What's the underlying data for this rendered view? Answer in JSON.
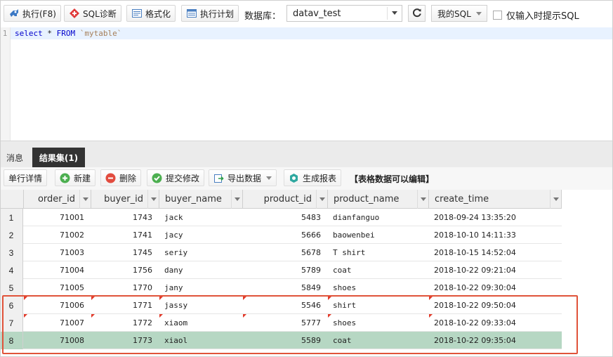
{
  "toolbar": {
    "execute_label": "执行(F8)",
    "sql_diagnose_label": "SQL诊断",
    "format_label": "格式化",
    "plan_label": "执行计划",
    "db_label": "数据库：",
    "db_value": "datav_test",
    "my_sql_label": "我的SQL",
    "only_hint_label": "仅输入时提示SQL"
  },
  "editor": {
    "line_number": "1",
    "kw_select": "select",
    "star": " * ",
    "kw_from": "FROM",
    "table": " `mytable`"
  },
  "tabs": {
    "messages": "消息",
    "result": "结果集(1)"
  },
  "result_toolbar": {
    "row_detail": "单行详情",
    "new": "新建",
    "delete": "删除",
    "submit": "提交修改",
    "export": "导出数据",
    "report": "生成报表",
    "note": "【表格数据可以编辑】"
  },
  "grid": {
    "columns": [
      "order_id",
      "buyer_id",
      "buyer_name",
      "product_id",
      "product_name",
      "create_time"
    ],
    "rows": [
      {
        "n": "1",
        "order_id": "71001",
        "buyer_id": "1743",
        "buyer_name": "jack",
        "product_id": "5483",
        "product_name": "dianfanguo",
        "create_time": "2018-09-24 13:35:20"
      },
      {
        "n": "2",
        "order_id": "71002",
        "buyer_id": "1741",
        "buyer_name": "jacy",
        "product_id": "5666",
        "product_name": "baowenbei",
        "create_time": "2018-10-10 14:11:33"
      },
      {
        "n": "3",
        "order_id": "71003",
        "buyer_id": "1745",
        "buyer_name": "seriy",
        "product_id": "5678",
        "product_name": "T shirt",
        "create_time": "2018-10-15 14:52:04"
      },
      {
        "n": "4",
        "order_id": "71004",
        "buyer_id": "1756",
        "buyer_name": "dany",
        "product_id": "5789",
        "product_name": "coat",
        "create_time": "2018-10-22 09:21:04"
      },
      {
        "n": "5",
        "order_id": "71005",
        "buyer_id": "1770",
        "buyer_name": "jany",
        "product_id": "5849",
        "product_name": "shoes",
        "create_time": "2018-10-22 09:30:04"
      },
      {
        "n": "6",
        "order_id": "71006",
        "buyer_id": "1771",
        "buyer_name": "jassy",
        "product_id": "5546",
        "product_name": "shirt",
        "create_time": "2018-10-22 09:50:04"
      },
      {
        "n": "7",
        "order_id": "71007",
        "buyer_id": "1772",
        "buyer_name": "xiaom",
        "product_id": "5777",
        "product_name": "shoes",
        "create_time": "2018-10-22 09:33:04"
      },
      {
        "n": "8",
        "order_id": "71008",
        "buyer_id": "1773",
        "buyer_name": "xiaol",
        "product_id": "5589",
        "product_name": "coat",
        "create_time": "2018-10-22 09:35:04"
      }
    ]
  },
  "colors": {
    "selected_row": "#b6d7c3",
    "highlight_box": "#e0533a",
    "edited_flag": "#e23a2a",
    "active_tab": "#333333"
  }
}
